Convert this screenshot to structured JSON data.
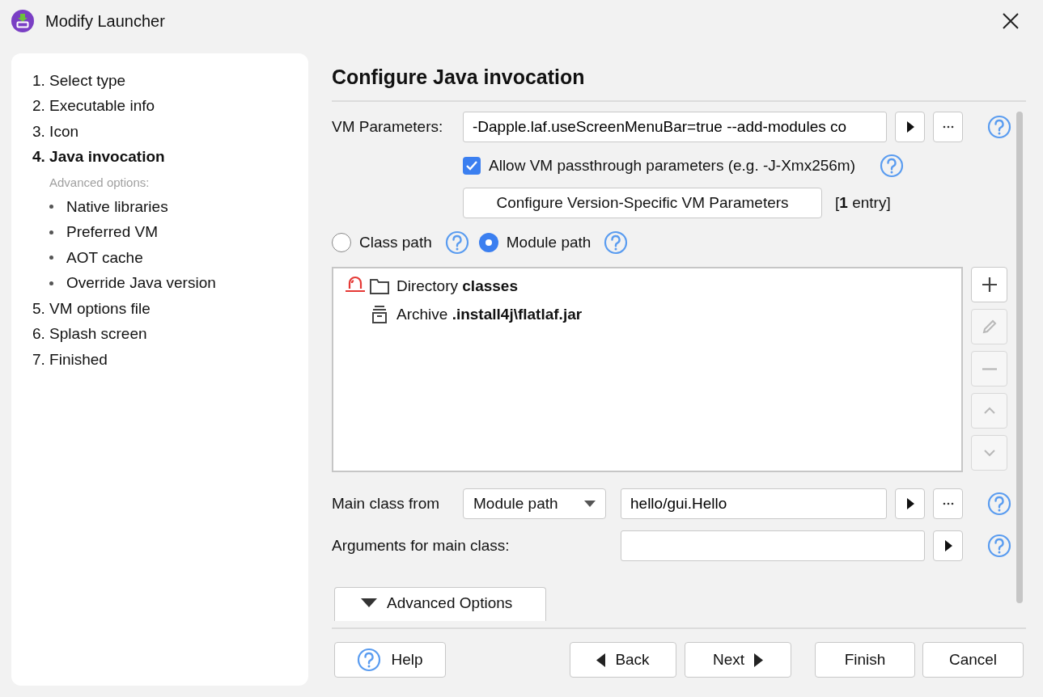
{
  "window": {
    "title": "Modify Launcher"
  },
  "steps": [
    {
      "label": "1. Select type",
      "selected": false
    },
    {
      "label": "2. Executable info",
      "selected": false
    },
    {
      "label": "3. Icon",
      "selected": false
    },
    {
      "label": "4. Java invocation",
      "selected": true,
      "sub_heading": "Advanced options:",
      "children": [
        {
          "label": "Native libraries"
        },
        {
          "label": "Preferred VM"
        },
        {
          "label": "AOT cache"
        },
        {
          "label": "Override Java version"
        }
      ]
    },
    {
      "label": "5. VM options file",
      "selected": false
    },
    {
      "label": "6. Splash screen",
      "selected": false
    },
    {
      "label": "7. Finished",
      "selected": false
    }
  ],
  "page": {
    "heading": "Configure Java invocation"
  },
  "vm_parameters": {
    "label": "VM Parameters:",
    "value": "-Dapple.laf.useScreenMenuBar=true --add-modules co"
  },
  "passthrough": {
    "label": "Allow VM passthrough parameters (e.g. -J-Xmx256m)",
    "checked": true
  },
  "version_specific": {
    "button": "Configure Version-Specific VM Parameters",
    "note": "[**1** entry]"
  },
  "path_options": [
    {
      "label": "Class path",
      "selected": false
    },
    {
      "label": "Module path",
      "selected": true
    }
  ],
  "entries": [
    {
      "kind": "directory",
      "text": "Directory **classes**",
      "warning": true
    },
    {
      "kind": "archive",
      "text": "Archive **.install4j\\flatlaf.jar**",
      "warning": false
    }
  ],
  "list_buttons": [
    {
      "kind": "add",
      "disabled": false
    },
    {
      "kind": "edit",
      "disabled": true
    },
    {
      "kind": "remove",
      "disabled": true
    },
    {
      "kind": "up",
      "disabled": true
    },
    {
      "kind": "down",
      "disabled": true
    }
  ],
  "main_class": {
    "label": "Main class from",
    "source": "Module path",
    "value": "hello/gui.Hello"
  },
  "arguments": {
    "label": "Arguments for main class:"
  },
  "advanced_options": {
    "label": "Advanced Options"
  },
  "buttons": [
    {
      "kind": "help",
      "label": "Help"
    },
    {
      "kind": "back",
      "label": "Back"
    },
    {
      "kind": "next",
      "label": "Next"
    },
    {
      "kind": "finish",
      "label": "Finish"
    },
    {
      "kind": "cancel",
      "label": "Cancel"
    }
  ]
}
